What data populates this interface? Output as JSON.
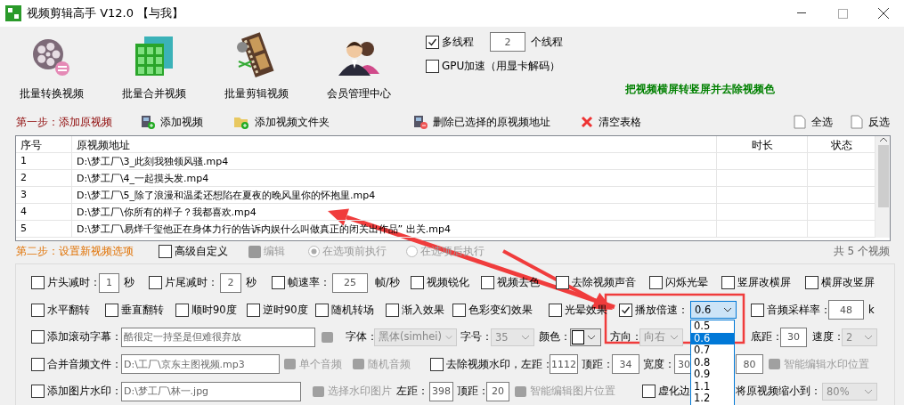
{
  "window": {
    "title": "视频剪辑高手 V12.0 【与我】"
  },
  "toolbar": {
    "tools": [
      {
        "label": "批量转换视频",
        "kind": "reel"
      },
      {
        "label": "批量合并视频",
        "kind": "grid"
      },
      {
        "label": "批量剪辑视频",
        "kind": "film"
      },
      {
        "label": "会员管理中心",
        "kind": "people"
      }
    ],
    "multithread": {
      "label": "多线程",
      "checked": true,
      "value": "2",
      "unit": "个线程"
    },
    "gpu": {
      "label": "GPU加速（用显卡解码）",
      "checked": false
    },
    "slogan": "把视频横屏转竖屏并去除视频色"
  },
  "step1": {
    "label": "第一步：添加原视频",
    "actions": [
      {
        "label": "添加视频",
        "kind": "film-add"
      },
      {
        "label": "添加视频文件夹",
        "kind": "folder-add"
      },
      {
        "label": "删除已选择的原视频地址",
        "kind": "film-delete"
      },
      {
        "label": "清空表格",
        "kind": "clear"
      }
    ],
    "select_all": "全选",
    "invert": "反选"
  },
  "table": {
    "columns": [
      "序号",
      "原视频地址",
      "时长",
      "状态"
    ],
    "rows": [
      {
        "no": "1",
        "path": "D:\\梦工厂\\3_此刻我独领风骚.mp4"
      },
      {
        "no": "2",
        "path": "D:\\梦工厂\\4_一起摸头发.mp4"
      },
      {
        "no": "3",
        "path": "D:\\梦工厂\\5_除了浪漫和温柔还想陷在夏夜的晚风里你的怀抱里.mp4"
      },
      {
        "no": "4",
        "path": "D:\\梦工厂\\你所有的样子？我都喜欢.mp4"
      },
      {
        "no": "5",
        "path": "D:\\梦工厂\\易烊千玺他正在身体力行的告诉内娱什么叫做真正的闭关出作品” 出关.mp4"
      }
    ]
  },
  "step2": {
    "label": "第二步：设置新视频选项",
    "advanced": {
      "label": "高级自定义",
      "checked": false
    },
    "edit": {
      "label": "编辑",
      "disabled": true
    },
    "radios": [
      {
        "label": "在选项前执行",
        "selected": true,
        "disabled": true
      },
      {
        "label": "在选项后执行",
        "selected": false,
        "disabled": true
      }
    ],
    "count": "共 5 个视频"
  },
  "options": [
    [
      {
        "kind": "check",
        "label": "片头减时：",
        "checked": false
      },
      {
        "kind": "field",
        "value": "1"
      },
      {
        "kind": "text",
        "label": "秒"
      },
      {
        "kind": "check",
        "label": "片尾减时：",
        "checked": false
      },
      {
        "kind": "field",
        "value": "2"
      },
      {
        "kind": "text",
        "label": "秒"
      },
      {
        "kind": "check",
        "label": "帧速率：",
        "checked": false
      },
      {
        "kind": "field",
        "value": "25"
      },
      {
        "kind": "text",
        "label": "帧/秒"
      },
      {
        "kind": "check",
        "label": "视频锐化",
        "checked": false
      },
      {
        "kind": "check",
        "label": "视频去色",
        "checked": false
      },
      {
        "kind": "check",
        "label": "去除视频声音",
        "checked": false
      },
      {
        "kind": "check",
        "label": "闪烁光晕",
        "checked": false
      },
      {
        "kind": "check",
        "label": "竖屏改横屏",
        "checked": false
      },
      {
        "kind": "check",
        "label": "横屏改竖屏",
        "checked": false
      }
    ],
    [
      {
        "kind": "check",
        "label": "水平翻转",
        "checked": false
      },
      {
        "kind": "check",
        "label": "垂直翻转",
        "checked": false
      },
      {
        "kind": "check",
        "label": "顺时90度",
        "checked": false
      },
      {
        "kind": "check",
        "label": "逆时90度",
        "checked": false
      },
      {
        "kind": "check",
        "label": "随机转场",
        "checked": false
      },
      {
        "kind": "check",
        "label": "渐入效果",
        "checked": false
      },
      {
        "kind": "check",
        "label": "色彩变幻效果",
        "checked": false
      },
      {
        "kind": "check",
        "label": "光晕效果",
        "checked": false
      },
      {
        "kind": "check",
        "label": "播放倍速：",
        "checked": true
      },
      {
        "kind": "select",
        "value": "0.6",
        "disabled": false,
        "open": true,
        "options": [
          {
            "label": "0.5",
            "selected": false
          },
          {
            "label": "0.6",
            "selected": true
          },
          {
            "label": "0.7",
            "selected": false
          },
          {
            "label": "0.8",
            "selected": false
          },
          {
            "label": "0.9",
            "selected": false
          },
          {
            "label": "1.1",
            "selected": false
          },
          {
            "label": "1.2",
            "selected": false
          }
        ]
      },
      {
        "kind": "check",
        "label": "音频采样率：",
        "checked": false
      },
      {
        "kind": "field",
        "value": "48"
      },
      {
        "kind": "text",
        "label": "k"
      }
    ],
    [
      {
        "kind": "check",
        "label": "添加滚动字幕：",
        "checked": false
      },
      {
        "kind": "wide-field",
        "value": "酷很定一持坚是但难很弃放"
      },
      {
        "kind": "tool",
        "disabled": true
      },
      {
        "kind": "text",
        "label": "字体："
      },
      {
        "kind": "select",
        "value": "黑体(simhei)",
        "disabled": true
      },
      {
        "kind": "text",
        "label": "字号："
      },
      {
        "kind": "select",
        "value": "35",
        "disabled": true
      },
      {
        "kind": "text",
        "label": "颜色："
      },
      {
        "kind": "color"
      },
      {
        "kind": "text",
        "label": "方向："
      },
      {
        "kind": "select",
        "value": "向右",
        "disabled": true
      },
      {
        "kind": "text",
        "label": "底距："
      },
      {
        "kind": "field",
        "value": "30"
      },
      {
        "kind": "text",
        "label": "速度："
      },
      {
        "kind": "select",
        "value": "2",
        "disabled": true
      }
    ],
    [
      {
        "kind": "check",
        "label": "合并音频文件：",
        "checked": false
      },
      {
        "kind": "wide-field",
        "value": "D:\\工厂\\京东主图视频.mp3"
      },
      {
        "kind": "tool",
        "label": "单个音频",
        "disabled": true
      },
      {
        "kind": "tool",
        "label": "随机音频",
        "disabled": true
      },
      {
        "kind": "check",
        "label": "去除视频水印，左距：",
        "checked": false
      },
      {
        "kind": "field",
        "value": "1112"
      },
      {
        "kind": "text",
        "label": "顶距："
      },
      {
        "kind": "field",
        "value": "34"
      },
      {
        "kind": "text",
        "label": "宽度："
      },
      {
        "kind": "cut-field",
        "value": "30"
      },
      {
        "kind": "field",
        "value": "80"
      },
      {
        "kind": "tool",
        "label": "智能编辑水印位置",
        "disabled": true
      }
    ],
    [
      {
        "kind": "check",
        "label": "添加图片水印：",
        "checked": false
      },
      {
        "kind": "wide-field",
        "value": "D:\\梦工厂\\林一.jpg"
      },
      {
        "kind": "tool",
        "label": "选择水印图片",
        "disabled": true
      },
      {
        "kind": "text",
        "label": "左距："
      },
      {
        "kind": "field",
        "value": "398"
      },
      {
        "kind": "text",
        "label": "顶距："
      },
      {
        "kind": "field",
        "value": "20"
      },
      {
        "kind": "tool",
        "label": "智能编辑图片位置",
        "disabled": true
      },
      {
        "kind": "check",
        "label": "虚化边",
        "checked": false
      },
      {
        "kind": "text",
        "label": "将原视频缩小到："
      },
      {
        "kind": "select",
        "value": "80%",
        "disabled": true
      }
    ]
  ]
}
